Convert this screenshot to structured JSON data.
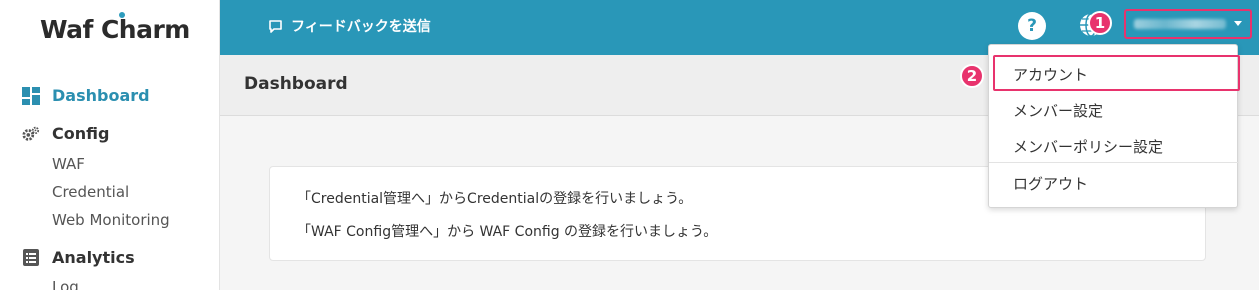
{
  "app": {
    "logo_part1": "Waf",
    "logo_part2": "Charm"
  },
  "header": {
    "feedback_label": "フィードバックを送信",
    "help_label": "?",
    "badge_1": "1",
    "badge_2": "2"
  },
  "sidebar": {
    "dashboard": "Dashboard",
    "config": "Config",
    "config_items": [
      "WAF",
      "Credential",
      "Web Monitoring"
    ],
    "analytics": "Analytics",
    "analytics_items": [
      "Log"
    ]
  },
  "main": {
    "page_title": "Dashboard",
    "messages": [
      "「Credential管理へ」からCredentialの登録を行いましょう。",
      "「WAF Config管理へ」から WAF Config の登録を行いましょう。"
    ]
  },
  "user_menu": {
    "items": [
      "アカウント",
      "メンバー設定",
      "メンバーポリシー設定",
      "ログアウト"
    ]
  },
  "colors": {
    "header_bg": "#2997b8",
    "accent_pink": "#e8336d",
    "active_nav": "#2b8fb0"
  }
}
